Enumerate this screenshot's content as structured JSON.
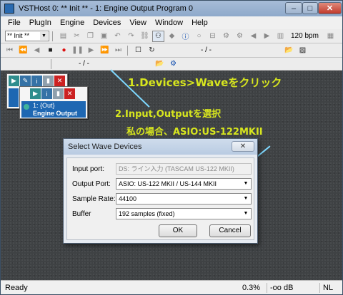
{
  "window": {
    "title": "VSTHost 0: ** Init ** - 1: Engine Output Program 0",
    "min_label": "–",
    "max_label": "□",
    "close_label": "✕"
  },
  "menu": [
    "File",
    "PlugIn",
    "Engine",
    "Devices",
    "View",
    "Window",
    "Help"
  ],
  "toolbar": {
    "preset_value": "** Init **",
    "bpm": "120 bpm",
    "position_display": "- / -",
    "position_display2": "- / -"
  },
  "plugins": [
    {
      "labels": [
        "1: {Out}",
        "Engine Output"
      ]
    }
  ],
  "callouts": {
    "step1": "1.Devices>Waveをクリック",
    "step2_line1": "2.Input,Outputを選択",
    "step2_line2": "私の場合、ASIO:US-122MKII"
  },
  "dialog": {
    "title": "Select Wave Devices",
    "close_label": "✕",
    "input_port_label": "Input port:",
    "input_port_value": "DS: ライン入力 (TASCAM US-122 MKII)",
    "output_port_label": "Output Port:",
    "output_port_value": "ASIO: US-122 MKII / US-144 MKII",
    "sample_rate_label": "Sample Rate:",
    "sample_rate_value": "44100",
    "buffer_label": "Buffer",
    "buffer_value": "192 samples (fixed)",
    "ok_label": "OK",
    "cancel_label": "Cancel"
  },
  "status": {
    "left": "Ready",
    "cpu": "0.3%",
    "level": "-oo dB",
    "mode": "NL"
  },
  "colors": {
    "callout_text": "#d7e61e",
    "callout_line": "#7ed8ff"
  }
}
